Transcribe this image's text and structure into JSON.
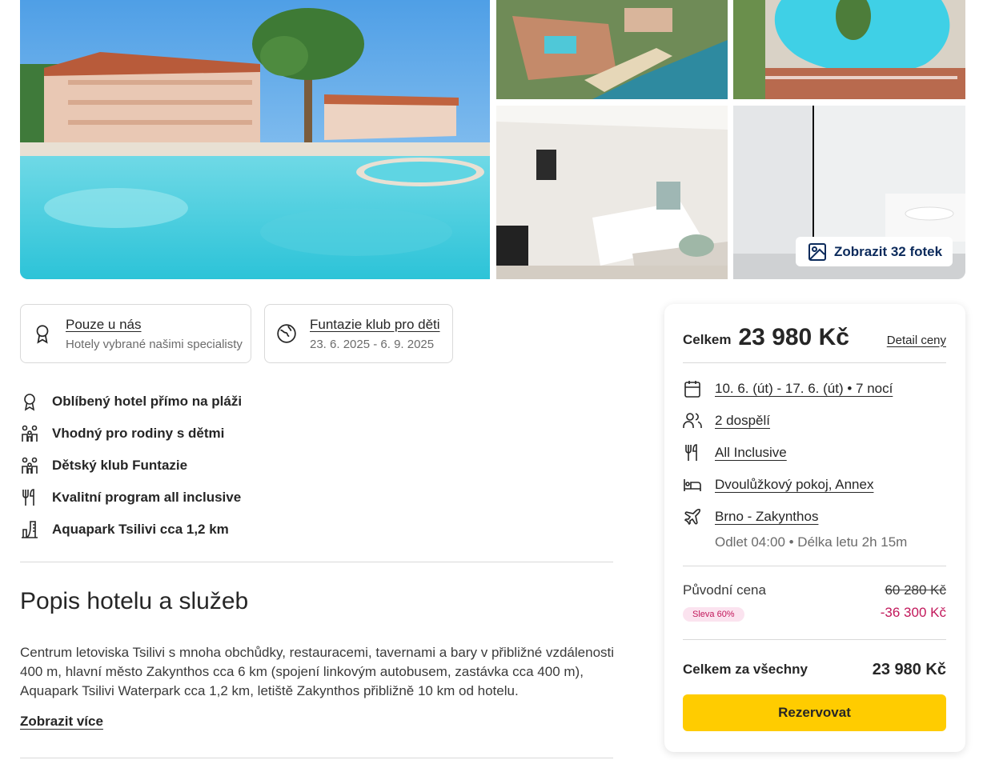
{
  "gallery": {
    "show_photos_label": "Zobrazit 32 fotek",
    "icon": "image-icon"
  },
  "badges": [
    {
      "title": "Pouze u nás",
      "subtitle": "Hotely vybrané našimi specialisty",
      "icon": "award-icon"
    },
    {
      "title": "Funtazie klub pro děti",
      "subtitle": "23. 6. 2025 - 6. 9. 2025",
      "icon": "globe-icon"
    }
  ],
  "features": [
    {
      "text": "Oblíbený hotel přímo na pláži",
      "icon": "award-icon"
    },
    {
      "text": "Vhodný pro rodiny s dětmi",
      "icon": "family-icon"
    },
    {
      "text": "Dětský klub Funtazie",
      "icon": "family-icon"
    },
    {
      "text": "Kvalitní program all inclusive",
      "icon": "cutlery-icon"
    },
    {
      "text": "Aquapark Tsilivi cca 1,2 km",
      "icon": "aquapark-icon"
    }
  ],
  "description": {
    "title": "Popis hotelu a služeb",
    "text": "Centrum letoviska Tsilivi s mnoha obchůdky, restauracemi, tavernami a bary v přibližné vzdálenosti 400 m, hlavní město Zakynthos cca 6 km (spojení linkovým autobusem, zastávka cca 400 m), Aquapark Tsilivi Waterpark cca 1,2 km, letiště Zakynthos přibližně 10 km od hotelu.",
    "show_more": "Zobrazit více"
  },
  "price_card": {
    "total_label": "Celkem",
    "total_value": "23 980 Kč",
    "detail_link": "Detail ceny",
    "dates": "10. 6. (út) - 17. 6. (út) • 7 nocí",
    "travelers": "2 dospělí",
    "board": "All Inclusive",
    "room": "Dvoulůžkový pokoj, Annex",
    "flight": "Brno - Zakynthos",
    "flight_info": "Odlet 04:00 • Délka letu 2h 15m",
    "original_label": "Původní cena",
    "original_value": "60 280 Kč",
    "sale_badge": "Sleva 60%",
    "discount_value": "-36 300 Kč",
    "sum_label": "Celkem za všechny",
    "sum_value": "23 980 Kč",
    "book_label": "Rezervovat",
    "colors": {
      "accent": "#ffcc00",
      "discount": "#c2185b",
      "sale_bg": "#fbe3ef"
    }
  }
}
